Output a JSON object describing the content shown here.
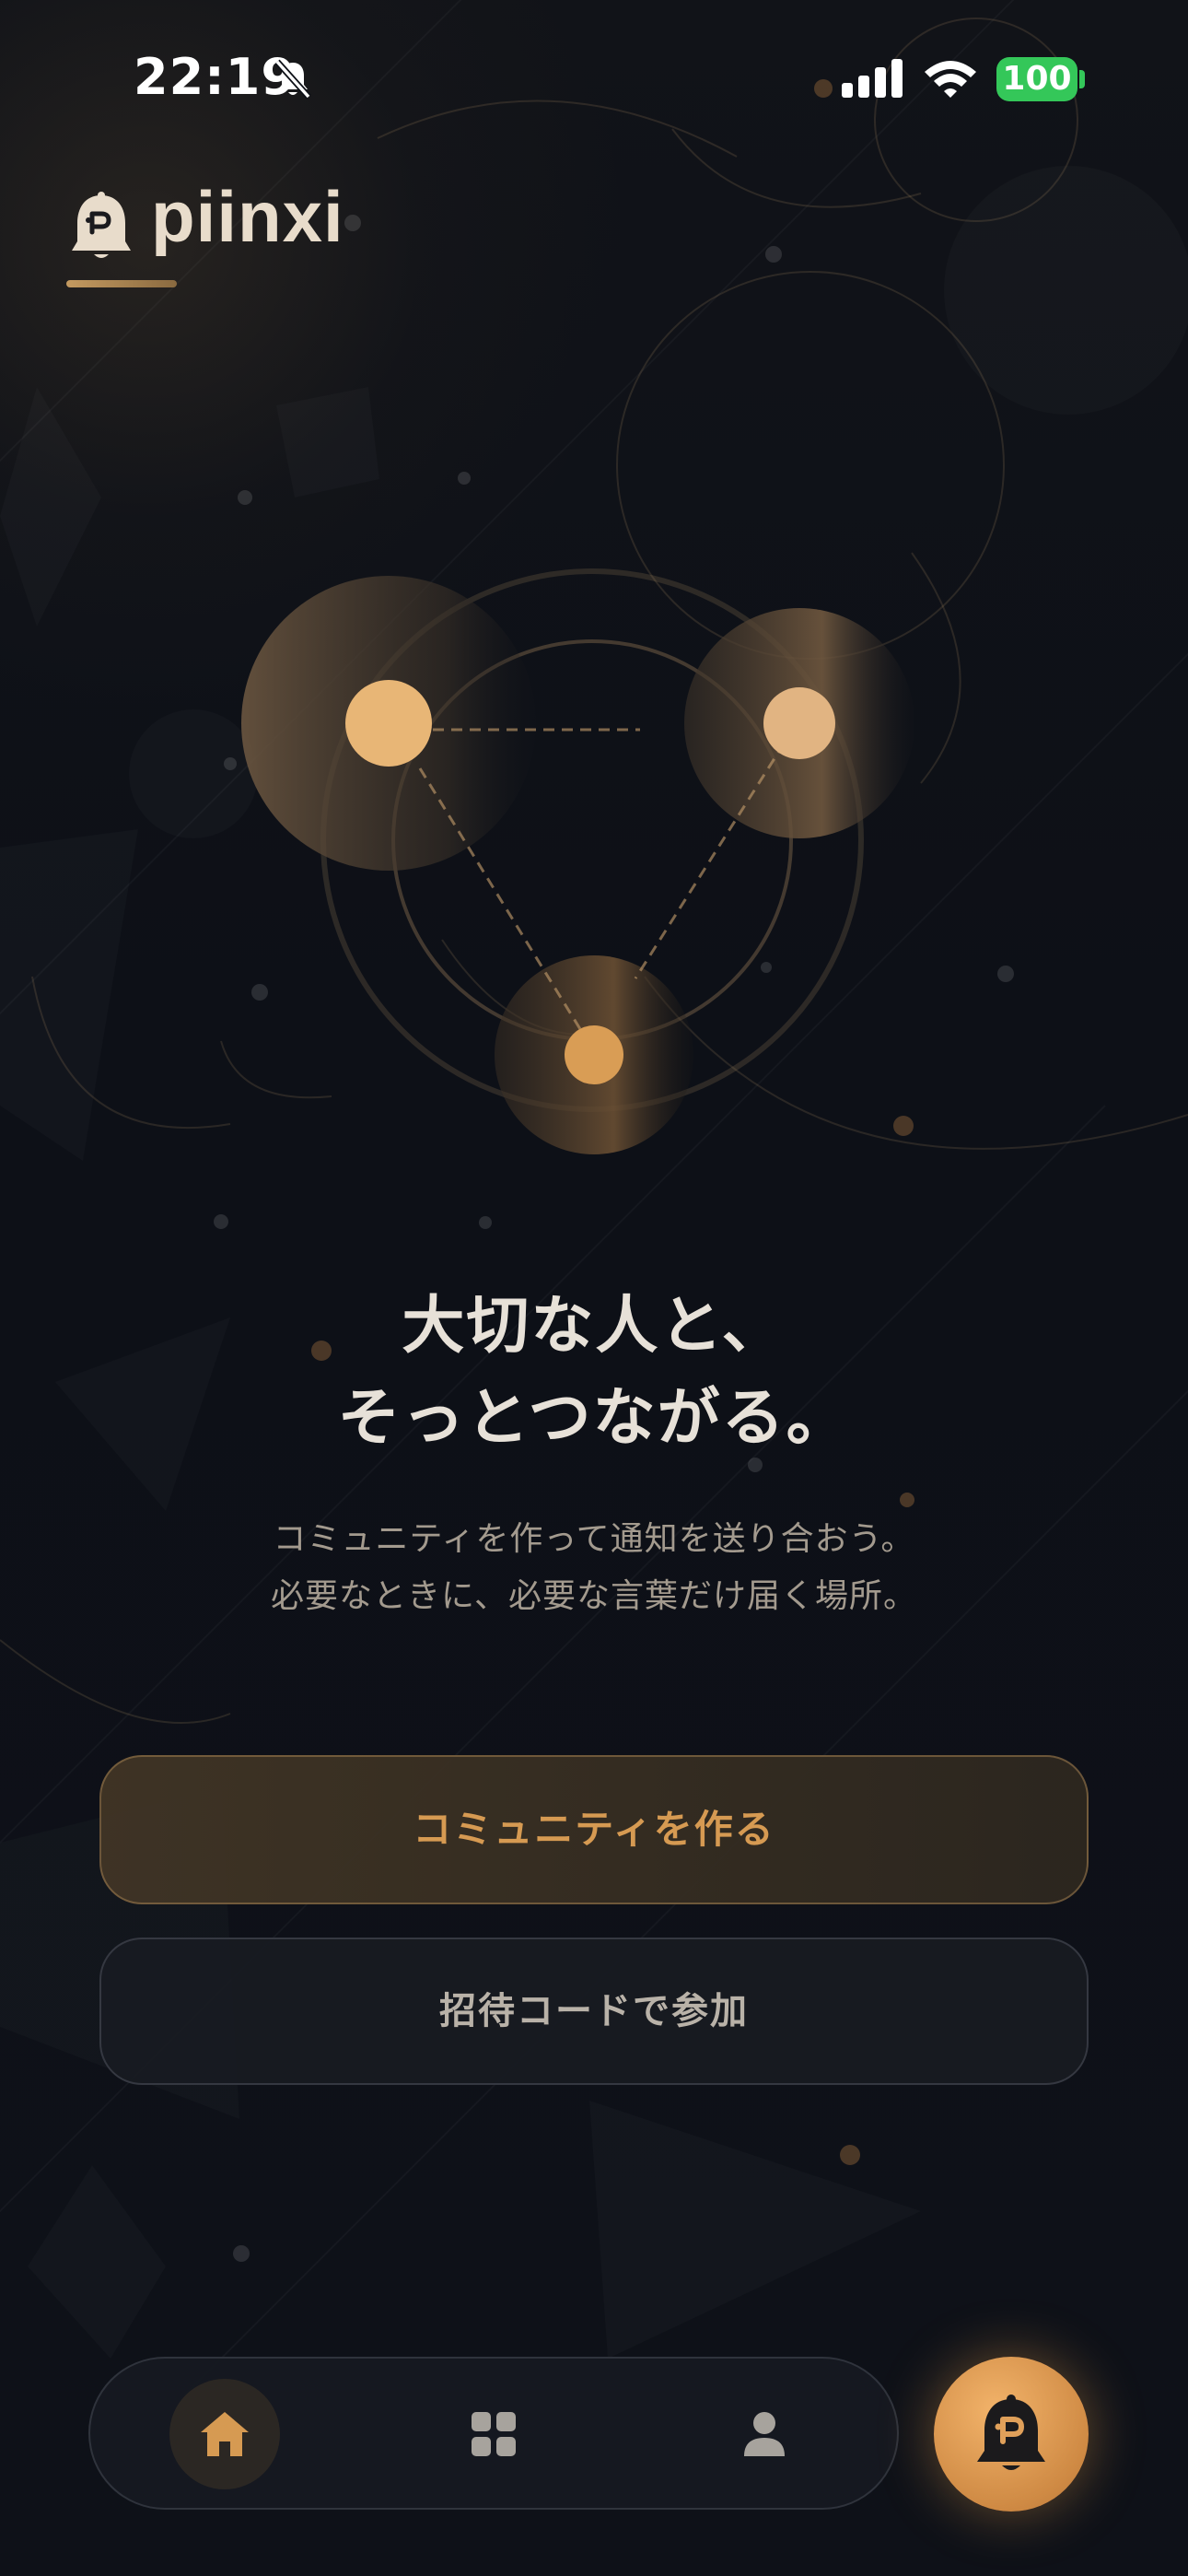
{
  "status_bar": {
    "time": "22:19",
    "battery": "100",
    "icons": [
      "bell-slash-icon",
      "cellular-signal-icon",
      "wifi-icon",
      "battery-icon"
    ]
  },
  "brand": {
    "name": "piinxi",
    "icon": "ghost-bell-icon",
    "accent_color": "#c49a60"
  },
  "hero": {
    "headline_lines": [
      "大切な人と、",
      "そっとつながる。"
    ],
    "subtext_lines": [
      "コミュニティを作って通知を送り合おう。",
      "必要なときに、必要な言葉だけ届く場所。"
    ]
  },
  "actions": {
    "create_community": "コミュニティを作る",
    "join_with_code": "招待コードで参加"
  },
  "bottom_nav": {
    "items": [
      {
        "name": "home",
        "icon": "home-icon",
        "active": true
      },
      {
        "name": "grid",
        "icon": "grid-icon",
        "active": false
      },
      {
        "name": "profile",
        "icon": "person-icon",
        "active": false
      }
    ],
    "fab_icon": "ghost-bell-icon"
  },
  "colors": {
    "background": "#0d1017",
    "accent": "#d69a52",
    "fab": "#e0a05a",
    "battery": "#34c759"
  }
}
